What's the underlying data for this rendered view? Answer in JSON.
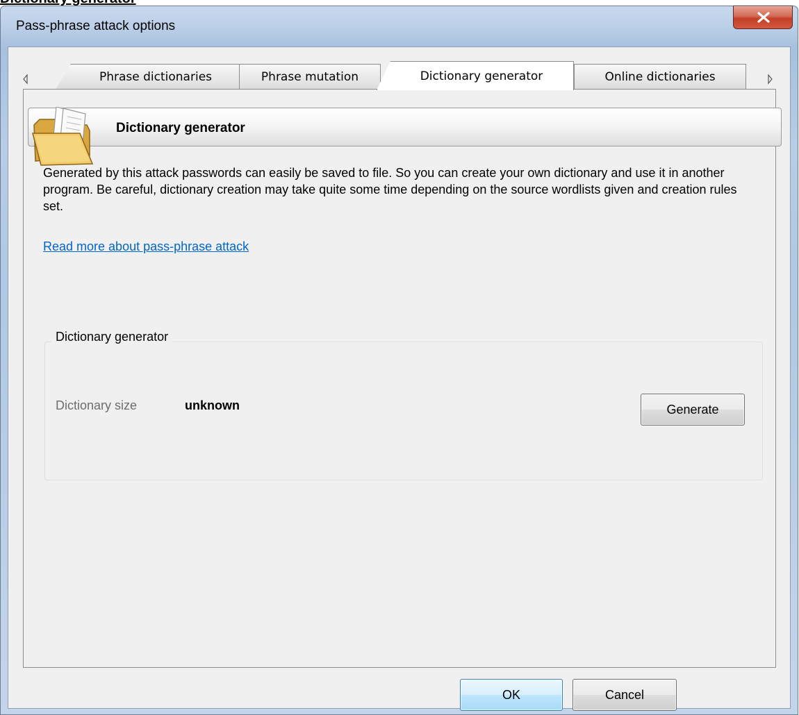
{
  "page_heading": "Dictionary generator",
  "window": {
    "title": "Pass-phrase attack options"
  },
  "tabs": [
    {
      "label": "Phrase dictionaries",
      "active": false
    },
    {
      "label": "Phrase mutation",
      "active": false
    },
    {
      "label": "Dictionary generator",
      "active": true
    },
    {
      "label": "Online dictionaries",
      "active": false
    }
  ],
  "panel": {
    "header_title": "Dictionary generator",
    "header_icon": "folder-icon",
    "description": "Generated by this attack passwords can easily be saved to file. So you can create your own dictionary and use it in another program. Be careful, dictionary creation may take quite some time depending on the source wordlists given and creation rules set.",
    "link_text": "Read more about pass-phrase attack",
    "group": {
      "legend": "Dictionary generator",
      "size_label": "Dictionary size",
      "size_value": "unknown",
      "generate_label": "Generate"
    }
  },
  "footer": {
    "ok_label": "OK",
    "cancel_label": "Cancel"
  },
  "colors": {
    "link": "#0066cc",
    "close_button": "#c33f27",
    "title_bar": "#bcd0e8"
  }
}
